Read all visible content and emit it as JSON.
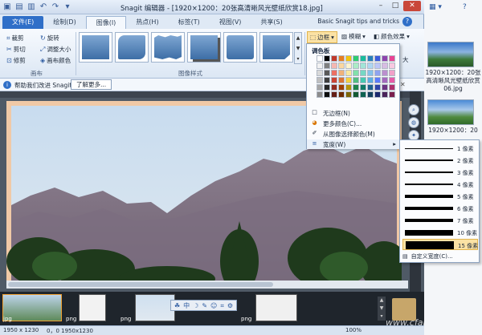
{
  "window": {
    "title": "Snagit 编辑器 - [1920×1200：20张高清晰风光壁纸欣赏18.jpg]"
  },
  "tabs": [
    {
      "label": "文件(E)"
    },
    {
      "label": "绘制(D)"
    },
    {
      "label": "图像(I)"
    },
    {
      "label": "热点(H)"
    },
    {
      "label": "标签(T)"
    },
    {
      "label": "视图(V)"
    },
    {
      "label": "共享(S)"
    }
  ],
  "tips_link": "Basic Snagit tips and tricks",
  "ribbon": {
    "canvas_group": {
      "crop": "裁剪",
      "cut": "剪切",
      "trim": "修剪",
      "rotate": "旋转",
      "resize": "调整大小",
      "canvas_color": "画布颜色",
      "label": "画布"
    },
    "styles_label": "图像样式",
    "border_label": "边框",
    "edge_label": "模糊",
    "color_effects_label": "颜色效果",
    "extra_label": "大"
  },
  "infobar": {
    "text": "帮助我们改进 Snagit",
    "button": "了解更多..."
  },
  "border_dropdown": {
    "palette_title": "调色板",
    "colors": [
      "#ffffff",
      "#000000",
      "#c0392b",
      "#e67e22",
      "#f1c40f",
      "#2ecc71",
      "#1abc9c",
      "#2980b9",
      "#3b5bdb",
      "#8e44ad",
      "#e84393",
      "#f2f2f2",
      "#7f7f7f",
      "#f5b7b1",
      "#fad7a0",
      "#fcf3cf",
      "#abebc6",
      "#a3e4d7",
      "#aed6f1",
      "#bcc6f7",
      "#d7bde2",
      "#f8c9e1",
      "#d9d9d9",
      "#595959",
      "#ec7063",
      "#f0b27a",
      "#f9e79f",
      "#82e0aa",
      "#76d7c4",
      "#85c1e9",
      "#8fa3ef",
      "#bb8fce",
      "#f1a0c9",
      "#bfbfbf",
      "#3f3f3f",
      "#cb4335",
      "#dc7633",
      "#f4d03f",
      "#52be80",
      "#48c9b0",
      "#5dade2",
      "#5c7cfa",
      "#a569bd",
      "#e75ba8",
      "#a6a6a6",
      "#262626",
      "#922b21",
      "#a04000",
      "#b7950b",
      "#1e8449",
      "#117a65",
      "#1f618d",
      "#2f44a8",
      "#6c3483",
      "#b0306f",
      "#8c8c8c",
      "#0d0d0d",
      "#641e16",
      "#6e2c00",
      "#7d6608",
      "#145a32",
      "#0e6251",
      "#154360",
      "#1c2a6e",
      "#4a235a",
      "#7a1f4d"
    ],
    "items": [
      {
        "label": "无边框(N)",
        "icon": "no-border-icon"
      },
      {
        "label": "更多颜色(C)...",
        "icon": "color-wheel-icon"
      },
      {
        "label": "从图像选择颜色(M)",
        "icon": "eyedropper-icon"
      },
      {
        "label": "宽度(W)",
        "icon": "width-icon"
      }
    ]
  },
  "width_submenu": {
    "options": [
      {
        "label": "1 像素",
        "width": 1
      },
      {
        "label": "2 像素",
        "width": 2
      },
      {
        "label": "3 像素",
        "width": 3
      },
      {
        "label": "4 像素",
        "width": 4
      },
      {
        "label": "5 像素",
        "width": 5
      },
      {
        "label": "6 像素",
        "width": 6
      },
      {
        "label": "7 像素",
        "width": 7
      },
      {
        "label": "10 像素",
        "width": 10
      },
      {
        "label": "15 像素",
        "width": 15
      }
    ],
    "selected": "15 像素",
    "custom": "自定义宽度(C)..."
  },
  "tray": {
    "items": [
      {
        "label": "jpg"
      },
      {
        "label": "png"
      },
      {
        "label": "png"
      },
      {
        "label": "png"
      }
    ]
  },
  "status": {
    "size": "1950 x 1230",
    "coords": "0，0  1950x1230",
    "zoom": "100%"
  },
  "explorer": {
    "items": [
      {
        "label": "1920×1200：20张高清晰风光壁纸欣赏06.jpg"
      },
      {
        "label": "1920×1200：20"
      }
    ]
  },
  "watermark": "www.cfan.com.cn"
}
